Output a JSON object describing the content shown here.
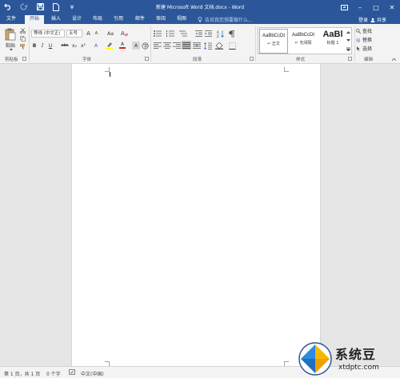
{
  "window": {
    "title": "新建 Microsoft Word 文档.docx - Word",
    "minimize_label": "–",
    "maximize_label": "□",
    "close_label": "✕"
  },
  "qat": {
    "icons": [
      "undo-icon",
      "redo-icon",
      "save-icon",
      "new-doc-icon",
      "customize-icon"
    ]
  },
  "tabs": [
    {
      "label": "文件"
    },
    {
      "label": "开始"
    },
    {
      "label": "插入"
    },
    {
      "label": "设计"
    },
    {
      "label": "布局"
    },
    {
      "label": "引用"
    },
    {
      "label": "邮件"
    },
    {
      "label": "审阅"
    },
    {
      "label": "视图"
    }
  ],
  "tellme": {
    "placeholder": "告诉我您想要做什么..."
  },
  "account": {
    "login": "登录",
    "share": "共享"
  },
  "ribbon": {
    "clipboard": {
      "label": "剪贴板",
      "paste": "粘贴"
    },
    "font": {
      "label": "字体",
      "font_name": "等线 (中文正)",
      "font_size": "五号",
      "grow": "A",
      "shrink": "A",
      "case": "Aa",
      "bold": "B",
      "italic": "I",
      "underline": "U",
      "strike": "abc",
      "subscript": "x₂",
      "superscript": "x²",
      "text_effect": "A",
      "font_color": "A",
      "char_shade": "A"
    },
    "paragraph": {
      "label": "段落"
    },
    "styles": {
      "label": "样式",
      "items": [
        {
          "sample": "AaBbCcDt",
          "name": "↵ 正文"
        },
        {
          "sample": "AaBbCcDt",
          "name": "↵ 无间隔"
        },
        {
          "sample": "AaBl",
          "name": "标题 1"
        }
      ]
    },
    "editing": {
      "label": "编辑",
      "find": "查找",
      "replace": "替换",
      "select": "选择"
    }
  },
  "status": {
    "page": "第 1 页，共 1 页",
    "words": "0 个字",
    "language": "中文(中国)"
  },
  "colors": {
    "accent": "#2b579a",
    "ribbon_bg": "#f3f3f3",
    "workspace": "#e6e6e6",
    "highlight": "#ffff00",
    "font_red": "#e02020"
  },
  "watermark": {
    "name": "系统豆",
    "url": "xtdptc.com"
  }
}
